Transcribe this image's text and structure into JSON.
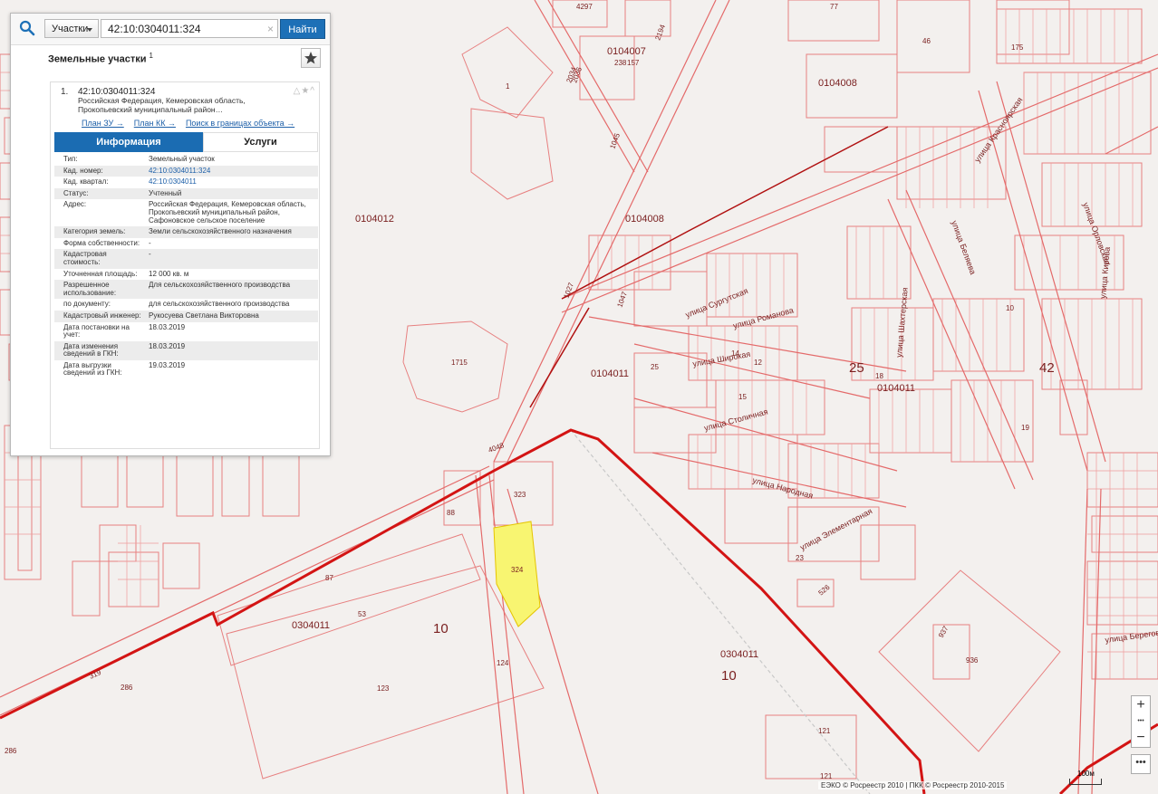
{
  "search": {
    "type_label": "Участки",
    "query": "42:10:0304011:324",
    "clear_icon": "×",
    "find_label": "Найти"
  },
  "panel": {
    "title": "Земельные участки",
    "title_count": "1",
    "result": {
      "index": "1.",
      "cad_number": "42:10:0304011:324",
      "address_short": "Российская Федерация, Кемеровская область, Прокопьевский муниципальный район…",
      "links": [
        "План ЗУ →",
        "План КК →",
        "Поиск в границах объекта →"
      ]
    },
    "tabs": [
      "Информация",
      "Услуги"
    ],
    "attributes": [
      {
        "k": "Тип:",
        "v": "Земельный участок"
      },
      {
        "k": "Кад. номер:",
        "v": "42:10:0304011:324",
        "link": true
      },
      {
        "k": "Кад. квартал:",
        "v": "42:10:0304011",
        "link": true
      },
      {
        "k": "Статус:",
        "v": "Учтенный"
      },
      {
        "k": "Адрес:",
        "v": "Российская Федерация, Кемеровская область, Прокопьевский муниципальный район, Сафоновское сельское поселение"
      },
      {
        "k": "Категория земель:",
        "v": "Земли сельскохозяйственного назначения"
      },
      {
        "k": "Форма собственности:",
        "v": "-"
      },
      {
        "k": "Кадастровая стоимость:",
        "v": "-"
      },
      {
        "k": "Уточненная площадь:",
        "v": "12 000 кв. м"
      },
      {
        "k": "Разрешенное использование:",
        "v": "Для сельскохозяйственного производства"
      },
      {
        "k": "по документу:",
        "v": "для сельскохозяйственного производства"
      },
      {
        "k": "Кадастровый инженер:",
        "v": "Рукосуева Светлана Викторовна"
      },
      {
        "k": "Дата постановки на учет:",
        "v": "18.03.2019"
      },
      {
        "k": "Дата изменения сведений в ГКН:",
        "v": "18.03.2019"
      },
      {
        "k": "Дата выгрузки сведений из ГКН:",
        "v": "19.03.2019"
      }
    ]
  },
  "map": {
    "quarters": [
      "0104007",
      "0104008",
      "0104012",
      "0104008",
      "0104011",
      "0104011",
      "0304011",
      "0304011"
    ],
    "big_numbers": [
      "25",
      "42",
      "10",
      "10"
    ],
    "parcels": [
      "1",
      "77",
      "1715",
      "323",
      "324",
      "88",
      "87",
      "53",
      "123",
      "124",
      "286",
      "319",
      "286",
      "936",
      "121",
      "121",
      "526",
      "937",
      "238",
      "157",
      "4297",
      "175",
      "46",
      "1045",
      "1047",
      "1027",
      "2034",
      "2036",
      "4048",
      "2194",
      "12",
      "14",
      "15",
      "18",
      "19",
      "23",
      "25",
      "10"
    ],
    "streets": [
      "улица Сургутская",
      "улица Романова",
      "улица Широкая",
      "улица Столичная",
      "улица Народная",
      "улица Элементарная",
      "улица Красноярская",
      "улица Беляева",
      "улица Береговая",
      "улица Кирова",
      "улица Шахтерская",
      "улица Орловская"
    ],
    "colors": {
      "line": "#e46a6a",
      "thick": "#d31414",
      "highlight": "#f8f571"
    }
  },
  "controls": {
    "zoom_in": "+",
    "zoom_dots": "•••",
    "zoom_out": "−",
    "more": "•••"
  },
  "credits": "ЕЭКО © Росреестр 2010 | ПКК © Росреестр 2010-2015",
  "scale": "100м"
}
